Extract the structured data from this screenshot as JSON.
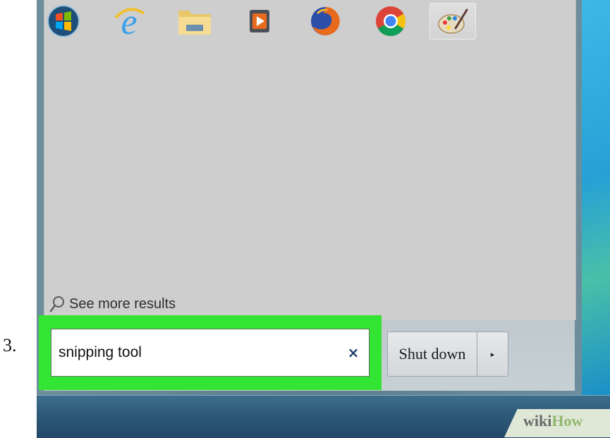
{
  "step": {
    "number": "3."
  },
  "start_menu": {
    "see_more_results": "See more results",
    "search": {
      "value": "snipping tool",
      "clear_glyph": "×"
    },
    "shutdown": {
      "label": "Shut down",
      "arrow_glyph": "▸"
    },
    "highlight_color": "#33e533"
  },
  "taskbar": {
    "items": [
      {
        "name": "start-orb-icon"
      },
      {
        "name": "internet-explorer-icon"
      },
      {
        "name": "file-explorer-icon"
      },
      {
        "name": "media-player-icon"
      },
      {
        "name": "firefox-icon"
      },
      {
        "name": "chrome-icon"
      },
      {
        "name": "paint-icon",
        "active": true
      }
    ]
  },
  "watermark": {
    "part1": "wiki",
    "part2": "How"
  }
}
